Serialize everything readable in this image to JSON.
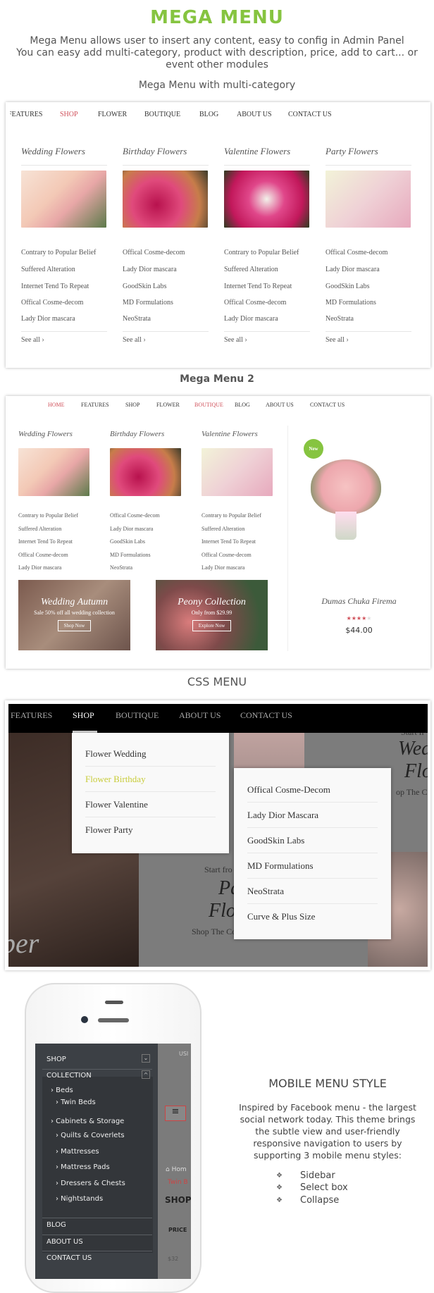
{
  "header": {
    "title": "MEGA MENU",
    "description_lines": [
      "Mega Menu allows user to insert any content,  easy to config  in Admin Panel",
      "You can easy add multi-category, product with description, price, add to cart... or",
      "event other modules"
    ],
    "subtitle": "Mega Menu with multi-category"
  },
  "mega1": {
    "nav": [
      "FEATURES",
      "SHOP",
      "FLOWER",
      "BOUTIQUE",
      "BLOG",
      "ABOUT US",
      "CONTACT US"
    ],
    "active": "SHOP",
    "columns": [
      {
        "title": "Wedding Flowers",
        "links": [
          "Contrary to Popular Belief",
          "Suffered Alteration",
          "Internet Tend To Repeat",
          "Offical Cosme-decom",
          "Lady Dior mascara"
        ],
        "see_all": "See all ›"
      },
      {
        "title": "Birthday Flowers",
        "links": [
          "Offical Cosme-decom",
          "Lady Dior mascara",
          "GoodSkin Labs",
          "MD Formulations",
          "NeoStrata"
        ],
        "see_all": "See all ›"
      },
      {
        "title": "Valentine Flowers",
        "links": [
          "Contrary to Popular Belief",
          "Suffered Alteration",
          "Internet Tend To Repeat",
          "Offical Cosme-decom",
          "Lady Dior mascara"
        ],
        "see_all": "See all ›"
      },
      {
        "title": "Party Flowers",
        "links": [
          "Offical Cosme-decom",
          "Lady Dior mascara",
          "GoodSkin Labs",
          "MD Formulations",
          "NeoStrata"
        ],
        "see_all": "See all ›"
      }
    ]
  },
  "mega2": {
    "label": "Mega Menu 2",
    "nav": [
      "HOME",
      "FEATURES",
      "SHOP",
      "FLOWER",
      "BOUTIQUE",
      "BLOG",
      "ABOUT US",
      "CONTACT US"
    ],
    "columns": [
      {
        "title": "Wedding Flowers",
        "links": [
          "Contrary to Popular Belief",
          "Suffered Alteration",
          "Internet Tend To Repeat",
          "Offical Cosme-decom",
          "Lady Dior mascara"
        ]
      },
      {
        "title": "Birthday Flowers",
        "links": [
          "Offical Cosme-decom",
          "Lady Dior mascara",
          "GoodSkin Labs",
          "MD Formulations",
          "NeoStrata"
        ]
      },
      {
        "title": "Valentine Flowers",
        "links": [
          "Contrary to Popular Belief",
          "Suffered Alteration",
          "Internet Tend To Repeat",
          "Offical Cosme-decom",
          "Lady Dior mascara"
        ]
      }
    ],
    "banners": [
      {
        "title": "Wedding Autumn",
        "subtitle": "Sale 50% off all wedding collection",
        "button": "Shop Now"
      },
      {
        "title": "Peony Collection",
        "subtitle": "Only from $29.99",
        "button": "Explore Now"
      }
    ],
    "product": {
      "badge": "New",
      "name": "Dumas Chuka Firema",
      "rating": 4,
      "rating_max": 5,
      "price": "$44.00"
    }
  },
  "css_menu": {
    "label": "CSS MENU",
    "nav": [
      "FEATURES",
      "SHOP",
      "BOUTIQUE",
      "ABOUT US",
      "CONTACT US"
    ],
    "active": "SHOP",
    "dropdown1": [
      "Flower Wedding",
      "Flower Birthday",
      "Flower Valentine",
      "Flower Party"
    ],
    "dropdown1_active": "Flower Birthday",
    "dropdown2": [
      "Offical Cosme-Decom",
      "Lady Dior Mascara",
      "GoodSkin Labs",
      "MD Formulations",
      "NeoStrata",
      "Curve & Plus Size"
    ],
    "background": {
      "start_from_1": "Start fr",
      "heading_1a": "Wed",
      "heading_1b": "Flo",
      "shop_1": "op The C",
      "start_from_2": "Start fro",
      "heading_2a": "Pa",
      "heading_2b": "Flo",
      "shop_2": "Shop The Collection",
      "side": "ber"
    }
  },
  "mobile": {
    "menu": {
      "shop": "SHOP",
      "collection": "COLLECTION",
      "items": [
        "› Beds",
        "› Twin Beds",
        "› Cabinets & Storage",
        "› Quilts & Coverlets",
        "› Mattresses",
        "› Mattress Pads",
        "› Dressers & Chests",
        "› Nightstands"
      ],
      "bottom": [
        "BLOG",
        "ABOUT US",
        "CONTACT US"
      ]
    },
    "behind": {
      "usd": "USI",
      "home": "Hom",
      "twin": "Twin B",
      "shop": "SHOP",
      "price": "PRICE",
      "price_val": "$32"
    },
    "title": "MOBILE MENU STYLE",
    "description_lines": [
      "Inspired by Facebook menu - the largest",
      "social network today. This theme brings",
      "the subtle view and user-friendly",
      "responsive navigation to users by",
      "supporting 3 mobile menu styles:"
    ],
    "styles": [
      "Sidebar",
      "Select box",
      "Collapse"
    ]
  },
  "colors": {
    "accent_green": "#86c440",
    "active_red": "#d0505a",
    "highlight_yellow": "#c8cc3a",
    "mobile_menu_bg": "#3c4045"
  }
}
